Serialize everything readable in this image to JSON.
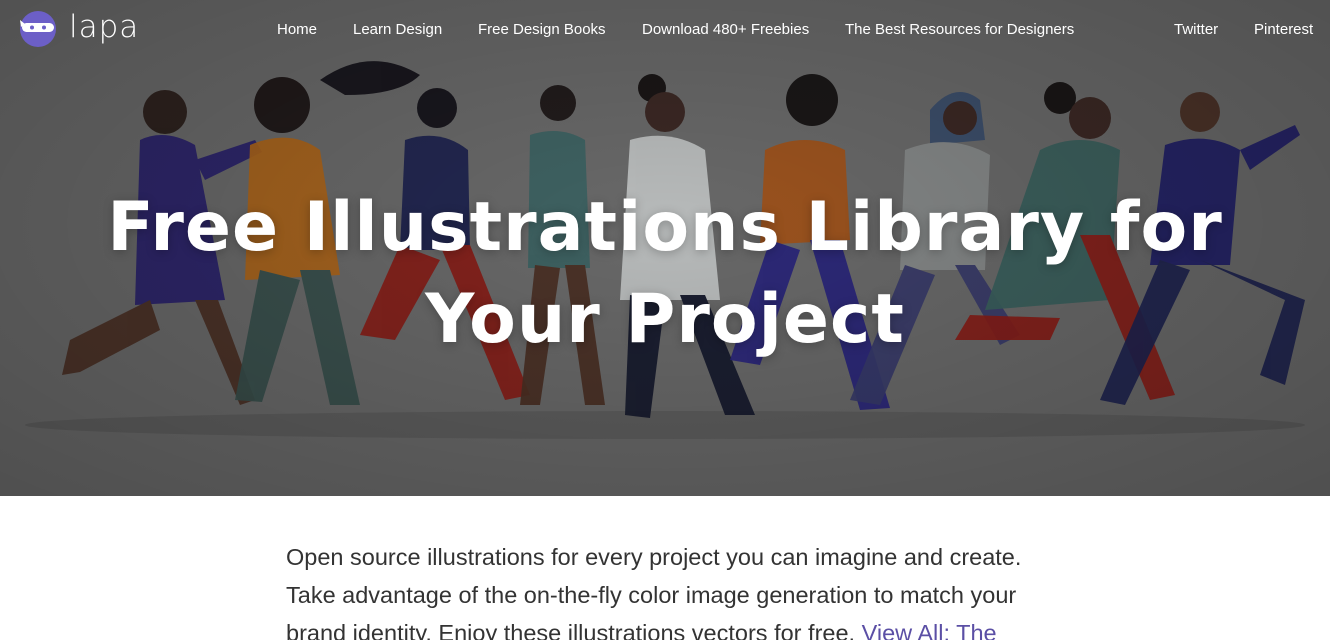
{
  "brand": {
    "name": "lapa",
    "logo_icon": "ninja-face-icon",
    "logo_color": "#6c5fc7"
  },
  "nav": {
    "items": [
      {
        "label": "Home"
      },
      {
        "label": "Learn Design"
      },
      {
        "label": "Free Design Books"
      },
      {
        "label": "Download 480+ Freebies"
      },
      {
        "label": "The Best Resources for Designers"
      }
    ],
    "social": [
      {
        "label": "Twitter"
      },
      {
        "label": "Pinterest"
      }
    ]
  },
  "hero": {
    "title_line1": "Free Illustrations Library for",
    "title_line2": "Your Project",
    "image": "group-of-people-walking-illustration"
  },
  "intro": {
    "text": "Open source illustrations for every project you can imagine and create. Take advantage of the on-the-fly color image generation to match your brand identity. Enjoy these illustrations vectors for free. ",
    "link_label": "View All: The"
  },
  "colors": {
    "link": "#5b4fa5",
    "hero_overlay": "#6b6b6b",
    "body_text": "#333333"
  }
}
